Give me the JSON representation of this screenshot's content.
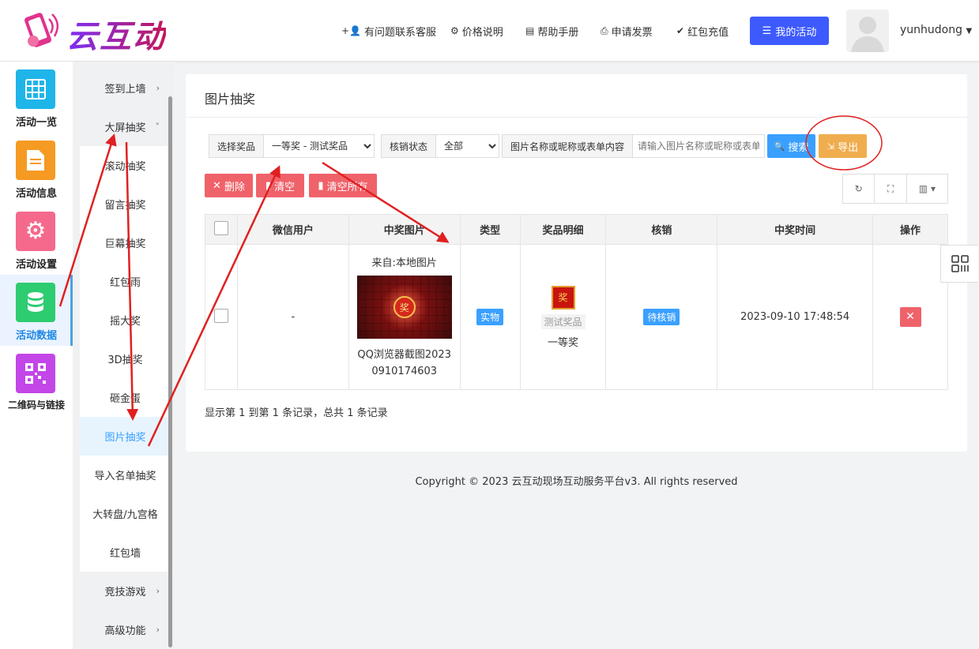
{
  "header": {
    "logo_text": "云互动",
    "nav": [
      "有问题联系客服",
      "价格说明",
      "帮助手册",
      "申请发票",
      "红包充值"
    ],
    "my_activity": "我的活动",
    "username": "yunhudong"
  },
  "left_modules": [
    {
      "label": "活动一览",
      "color": "#1fb5e8",
      "icon": "grid-icon"
    },
    {
      "label": "活动信息",
      "color": "#f59a23",
      "icon": "document-icon"
    },
    {
      "label": "活动设置",
      "color": "#f56a8c",
      "icon": "gear-icon"
    },
    {
      "label": "活动数据",
      "color": "#2ecc71",
      "icon": "database-icon"
    },
    {
      "label": "二维码与链接",
      "color": "#c346e8",
      "icon": "qrcode-icon"
    }
  ],
  "submenu": {
    "signin": "签到上墙",
    "bigscreen": "大屏抽奖",
    "items": [
      "滚动抽奖",
      "留言抽奖",
      "巨幕抽奖",
      "红包雨",
      "摇大奖",
      "3D抽奖",
      "砸金蛋",
      "图片抽奖",
      "导入名单抽奖",
      "大转盘/九宫格",
      "红包墙"
    ],
    "games": "竞技游戏",
    "advanced": "高级功能"
  },
  "panel": {
    "title": "图片抽奖",
    "filter_prize_label": "选择奖品",
    "filter_prize_value": "一等奖 - 测试奖品",
    "filter_status_label": "核销状态",
    "filter_status_value": "全部",
    "filter_search_label": "图片名称或昵称或表单内容",
    "filter_search_placeholder": "请输入图片名称或昵称或表单内容",
    "search_btn": "搜索",
    "export_btn": "导出",
    "delete_btn": "删除",
    "clear_btn": "清空",
    "clear_all_btn": "清空所有"
  },
  "table": {
    "headers": [
      "微信用户",
      "中奖图片",
      "类型",
      "奖品明细",
      "核销",
      "中奖时间",
      "操作"
    ],
    "rows": [
      {
        "user": "-",
        "image_source": "来自:本地图片",
        "image_name": "QQ浏览器截图20230910174603",
        "type": "实物",
        "prize_name": "测试奖品",
        "prize_level": "一等奖",
        "verify": "待核销",
        "time": "2023-09-10 17:48:54"
      }
    ]
  },
  "summary": "显示第 1 到第 1 条记录，总共 1 条记录",
  "copyright": "Copyright © 2023 云互动现场互动服务平台v3. All rights reserved",
  "colors": {
    "accent": "#3d5afe",
    "search": "#3aa0ff",
    "export": "#f0ad4e",
    "danger": "#f0626a",
    "active_text": "#3aa0ff"
  }
}
